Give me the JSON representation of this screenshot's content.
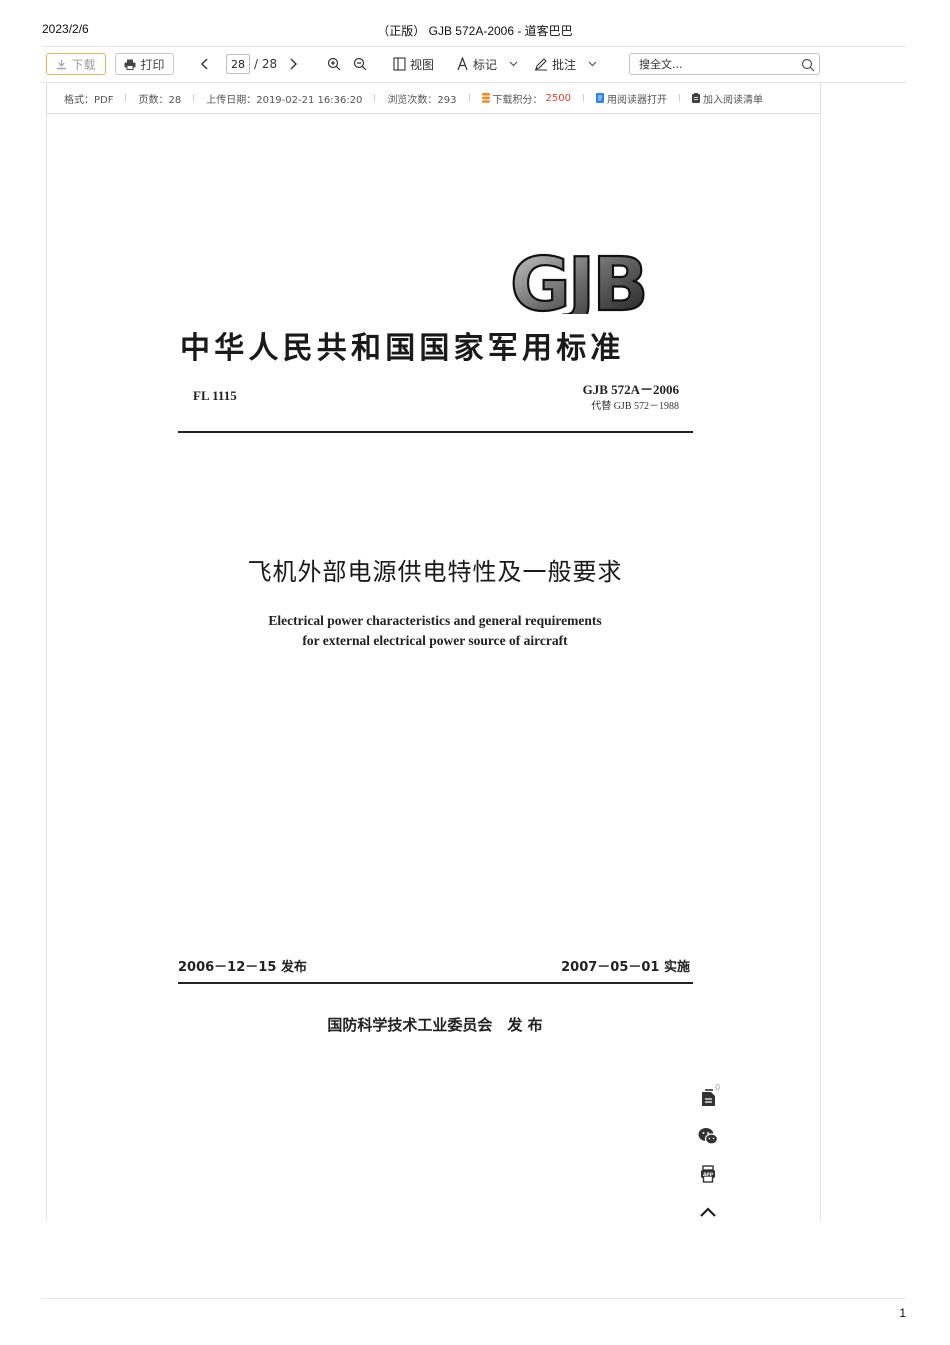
{
  "print_header": {
    "date": "2023/2/6",
    "title": "（正版） GJB 572A-2006 - 道客巴巴"
  },
  "toolbar": {
    "download_label": "下载",
    "print_label": "打印",
    "page_current": "28",
    "page_total": "/ 28",
    "view_label": "视图",
    "mark_label": "标记",
    "annotate_label": "批注",
    "search_placeholder": "搜全文..."
  },
  "meta": {
    "format": "格式：PDF",
    "pages": "页数：28",
    "upload_date": "上传日期：2019-02-21 16:36:20",
    "views": "浏览次数：293",
    "points_label": "下载积分：",
    "points_value": "2500",
    "open_reader": "用阅读器打开",
    "add_reading_list": "加入阅读清单"
  },
  "document": {
    "logo_text": "GJB",
    "national_std": "中华人民共和国国家军用标准",
    "fl_code": "FL  1115",
    "std_number": "GJB  572A－2006",
    "replaces": "代替 GJB 572－1988",
    "title_cn": "飞机外部电源供电特性及一般要求",
    "title_en_line1": "Electrical power characteristics and general requirements",
    "title_en_line2": "for external electrical power source of aircraft",
    "publish_date": "2006－12－15 发布",
    "effective_date": "2007－05－01 实施",
    "issuer": "国防科学技术工业委员会　发 布"
  },
  "side_tools": {
    "note_count": "0"
  },
  "footer": {
    "page_number": "1"
  },
  "colors": {
    "download_border": "#e6b15e",
    "points_red": "#e03a2f",
    "coin_orange": "#f08a24",
    "reader_blue": "#2f86e0"
  }
}
